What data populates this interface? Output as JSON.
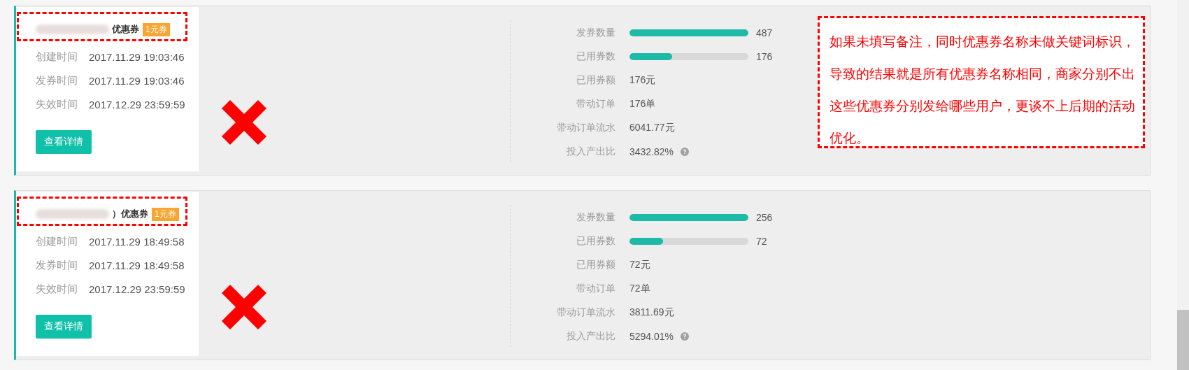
{
  "cards": [
    {
      "title": "优惠券",
      "tag": "1元券",
      "title_highlighted": true,
      "crossed_out": true,
      "fields": [
        {
          "label": "创建时间",
          "value": "2017.11.29 19:03:46"
        },
        {
          "label": "发券时间",
          "value": "2017.11.29 19:03:46"
        },
        {
          "label": "失效时间",
          "value": "2017.12.29 23:59:59"
        }
      ],
      "button": "查看详情",
      "stats": [
        {
          "kind": "bar",
          "label": "发券数量",
          "level": 1,
          "value": "487"
        },
        {
          "kind": "bar",
          "label": "已用券数",
          "level": 0.36,
          "value": "176"
        },
        {
          "kind": "text",
          "label": "已用券额",
          "value": "176元"
        },
        {
          "kind": "text",
          "label": "带动订单",
          "value": "176单"
        },
        {
          "kind": "text",
          "label": "带动订单流水",
          "value": "6041.77元"
        },
        {
          "kind": "help",
          "label": "投入产出比",
          "value": "3432.82%"
        }
      ],
      "note": "如果未填写备注，同时优惠券名称未做关键词标识，导致的结果就是所有优惠券名称相同，商家分别不出这些优惠券分别发给哪些用户，更谈不上后期的活动优化。"
    },
    {
      "title": "）优惠券",
      "tag": "1元券",
      "title_highlighted": true,
      "crossed_out": true,
      "fields": [
        {
          "label": "创建时间",
          "value": "2017.11.29 18:49:58"
        },
        {
          "label": "发券时间",
          "value": "2017.11.29 18:49:58"
        },
        {
          "label": "失效时间",
          "value": "2017.12.29 23:59:59"
        }
      ],
      "button": "查看详情",
      "stats": [
        {
          "kind": "bar",
          "label": "发券数量",
          "level": 1,
          "value": "256"
        },
        {
          "kind": "bar",
          "label": "已用券数",
          "level": 0.28,
          "value": "72"
        },
        {
          "kind": "text",
          "label": "已用券额",
          "value": "72元"
        },
        {
          "kind": "text",
          "label": "带动订单",
          "value": "72单"
        },
        {
          "kind": "text",
          "label": "带动订单流水",
          "value": "3811.69元"
        },
        {
          "kind": "help",
          "label": "投入产出比",
          "value": "5294.01%"
        }
      ]
    }
  ]
}
